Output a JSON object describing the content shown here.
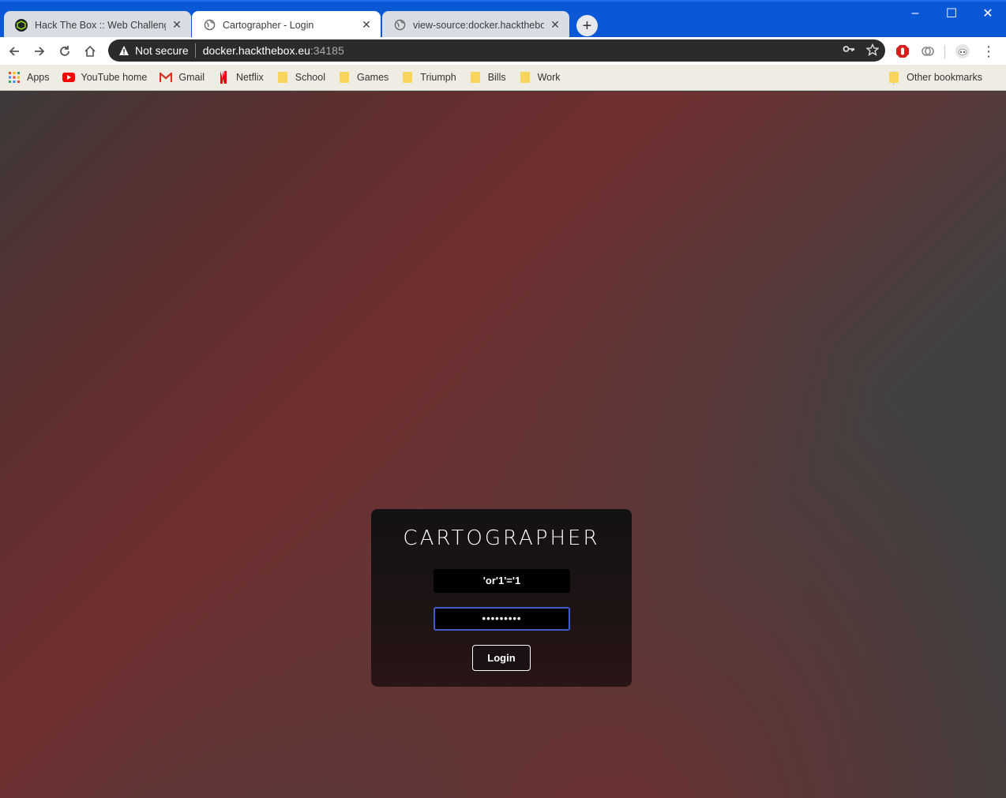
{
  "tabs": [
    {
      "title": "Hack The Box :: Web Challenges",
      "state": "inactive"
    },
    {
      "title": "Cartographer - Login",
      "state": "active"
    },
    {
      "title": "view-source:docker.hackthebox.e",
      "state": "inactive"
    }
  ],
  "address_bar": {
    "security": "Not secure",
    "host": "docker.hackthebox.eu",
    "port": ":34185"
  },
  "bookmarks": [
    {
      "label": "Apps",
      "icon": "apps-grid-icon"
    },
    {
      "label": "YouTube home",
      "icon": "youtube-icon"
    },
    {
      "label": "Gmail",
      "icon": "gmail-icon"
    },
    {
      "label": "Netflix",
      "icon": "netflix-icon"
    },
    {
      "label": "School",
      "icon": "folder-icon"
    },
    {
      "label": "Games",
      "icon": "folder-icon"
    },
    {
      "label": "Triumph",
      "icon": "folder-icon"
    },
    {
      "label": "Bills",
      "icon": "folder-icon"
    },
    {
      "label": "Work",
      "icon": "folder-icon"
    }
  ],
  "other_bookmarks": "Other bookmarks",
  "login": {
    "logo": "CARTOGRAPHER",
    "username": "'or'1'='1",
    "password_mask": "•••••••••",
    "submit": "Login"
  },
  "colors": {
    "titlebar": "#0a58d6",
    "input_focus": "#3d5ec9",
    "accent_red": "#702f30"
  }
}
